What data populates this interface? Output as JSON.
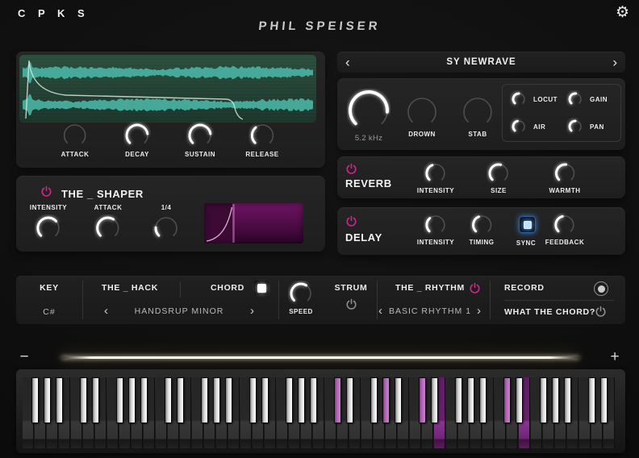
{
  "header": {
    "logo": "C P K S",
    "brand": "PHIL SPEISER"
  },
  "icons": {
    "gear": "⚙",
    "chevron_left": "‹",
    "chevron_right": "›",
    "minus": "−",
    "plus": "+"
  },
  "sampler": {
    "adsr": [
      {
        "label": "ATTACK",
        "value": 0
      },
      {
        "label": "DECAY",
        "value": 0.8
      },
      {
        "label": "SUSTAIN",
        "value": 0.8
      },
      {
        "label": "RELEASE",
        "value": 0.35
      }
    ]
  },
  "preset": {
    "name": "SY NEWRAVE"
  },
  "filter": {
    "cutoff": {
      "label": "5.2 kHz",
      "value": 0.85
    },
    "drown": {
      "label": "DROWN",
      "value": 0
    },
    "stab": {
      "label": "STAB",
      "value": 0
    },
    "quad": [
      {
        "label": "LOCUT",
        "value": 0.5
      },
      {
        "label": "GAIN",
        "value": 0.52
      },
      {
        "label": "AIR",
        "value": 0.45
      },
      {
        "label": "PAN",
        "value": 0.5
      }
    ]
  },
  "shaper": {
    "title": "THE _ SHAPER",
    "knobs": [
      {
        "label": "INTENSITY",
        "value": 0.68
      },
      {
        "label": "ATTACK",
        "value": 0.62
      },
      {
        "label": "1/4",
        "value": 0.18
      }
    ]
  },
  "reverb": {
    "title": "REVERB",
    "knobs": [
      {
        "label": "INTENSITY",
        "value": 0.42
      },
      {
        "label": "SIZE",
        "value": 0.55
      },
      {
        "label": "WARMTH",
        "value": 0.52
      }
    ]
  },
  "delay": {
    "title": "DELAY",
    "knobs": [
      {
        "label": "INTENSITY",
        "value": 0.35
      },
      {
        "label": "TIMING",
        "value": 0.42
      }
    ],
    "sync": {
      "label": "SYNC",
      "on": true
    },
    "feedback": {
      "label": "FEEDBACK",
      "value": 0.45
    }
  },
  "bottom": {
    "key_label": "KEY",
    "key_value": "C#",
    "hack_title": "THE _ HACK",
    "chord_label": "CHORD",
    "chord_on": true,
    "hack_selection": "HANDSRUP MINOR",
    "strum_label": "STRUM",
    "speed": {
      "label": "SPEED",
      "value": 0.62
    },
    "rhythm_title": "THE _ RHYTHM",
    "rhythm_selection": "BASIC RHYTHM 1",
    "record_label": "RECORD",
    "wtc_label": "WHAT THE CHORD?"
  },
  "keyboard": {
    "white_key_count": 49,
    "note_cycle": [
      "F",
      "G",
      "A",
      "B",
      "C",
      "D",
      "E"
    ],
    "black_after": [
      "F",
      "G",
      "A",
      "C",
      "D"
    ],
    "highlighted_black": [
      "C#4",
      "C#5",
      "G#5",
      "C#6"
    ],
    "highlighted_white": [
      "E5",
      "E6"
    ]
  },
  "colors": {
    "accent_magenta": "#d6268e",
    "power_grey": "#8f8f8f",
    "sync_blue": "#4d9df5",
    "wave_teal": "#49b2a3"
  }
}
